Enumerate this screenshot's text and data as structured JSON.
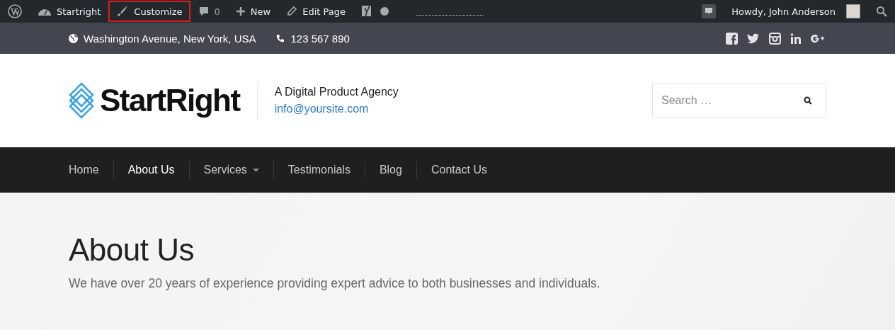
{
  "admin_bar": {
    "left": [
      {
        "kind": "wp-logo",
        "highlighted": false
      },
      {
        "kind": "site",
        "label": "Startright",
        "highlighted": false
      },
      {
        "kind": "customize",
        "label": "Customize",
        "highlighted": true
      },
      {
        "kind": "comments",
        "label": "0",
        "highlighted": false
      },
      {
        "kind": "new",
        "label": "New",
        "highlighted": false
      },
      {
        "kind": "edit",
        "label": "Edit Page",
        "highlighted": false
      },
      {
        "kind": "seo",
        "highlighted": false
      }
    ],
    "right": [
      {
        "kind": "notice"
      },
      {
        "kind": "account",
        "label": "Howdy, John Anderson"
      },
      {
        "kind": "search"
      }
    ]
  },
  "top_bar": {
    "address": "Washington Avenue, New York, USA",
    "phone": "123 567 890",
    "social": [
      {
        "kind": "facebook"
      },
      {
        "kind": "twitter"
      },
      {
        "kind": "instagram"
      },
      {
        "kind": "linkedin"
      },
      {
        "kind": "google-plus"
      }
    ]
  },
  "header": {
    "logo": "StartRight",
    "tagline": "A Digital Product Agency",
    "email": "info@yoursite.com",
    "search": {
      "placeholder": "Search …"
    }
  },
  "nav": [
    {
      "label": "Home",
      "selected": false,
      "dropdown": false
    },
    {
      "label": "About Us",
      "selected": true,
      "dropdown": false
    },
    {
      "label": "Services",
      "selected": false,
      "dropdown": true
    },
    {
      "label": "Testimonials",
      "selected": false,
      "dropdown": false
    },
    {
      "label": "Blog",
      "selected": false,
      "dropdown": false
    },
    {
      "label": "Contact Us",
      "selected": false,
      "dropdown": false
    }
  ],
  "hero": {
    "title": "About Us",
    "subtitle": "We have over 20 years of experience providing expert advice to both businesses and individuals."
  }
}
